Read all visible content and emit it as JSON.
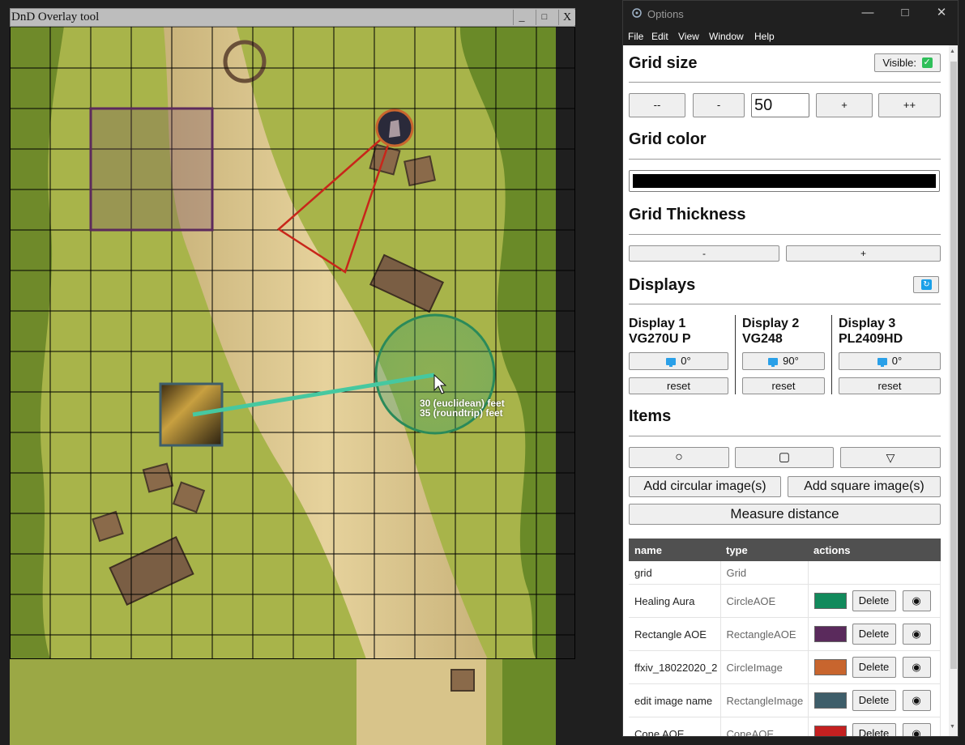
{
  "map_window": {
    "title": "DnD Overlay tool",
    "minimize": "_",
    "maximize": "□",
    "close": "X",
    "measure": {
      "line1": "30 (euclidean) feet",
      "line2": "35 (roundtrip) feet"
    },
    "colors": {
      "grid": "#000000",
      "healing_aura": "#1a8a5a",
      "rectangle_aoe": "#5c2a5c",
      "cone": "#c8261a",
      "measure_line": "#46c8a0"
    }
  },
  "options_window": {
    "title": "Options",
    "menu": [
      "File",
      "Edit",
      "View",
      "Window",
      "Help"
    ],
    "grid_size": {
      "title": "Grid size",
      "visible_label": "Visible:",
      "visible_checked": true,
      "buttons": [
        "--",
        "-",
        "+",
        "++"
      ],
      "value": "50"
    },
    "grid_color": {
      "title": "Grid color",
      "value": "#000000"
    },
    "grid_thickness": {
      "title": "Grid Thickness",
      "minus": "-",
      "plus": "+"
    },
    "displays": {
      "title": "Displays",
      "refresh_icon": "refresh-icon",
      "items": [
        {
          "line1": "Display 1",
          "line2": "VG270U P",
          "rotation": "0°",
          "reset": "reset"
        },
        {
          "line1": "Display 2",
          "line2": "VG248",
          "rotation": "90°",
          "reset": "reset"
        },
        {
          "line1": "Display 3",
          "line2": "PL2409HD",
          "rotation": "0°",
          "reset": "reset"
        }
      ]
    },
    "items": {
      "title": "Items",
      "shape_buttons": [
        "○",
        "▢",
        "▽"
      ],
      "add_circular": "Add circular image(s)",
      "add_square": "Add square image(s)",
      "measure": "Measure distance",
      "columns": [
        "name",
        "type",
        "actions"
      ],
      "rows": [
        {
          "name": "grid",
          "type": "Grid"
        },
        {
          "name": "Healing Aura",
          "type": "CircleAOE",
          "color": "#128a5c",
          "delete": "Delete"
        },
        {
          "name": "Rectangle AOE",
          "type": "RectangleAOE",
          "color": "#5a2a5c",
          "delete": "Delete"
        },
        {
          "name": "ffxiv_18022020_2",
          "type": "CircleImage",
          "color": "#c8652e",
          "delete": "Delete"
        },
        {
          "name": "edit image name",
          "type": "RectangleImage",
          "color": "#3e5e6a",
          "delete": "Delete"
        },
        {
          "name": "Cone AOE",
          "type": "ConeAOE",
          "color": "#c42020",
          "delete": "Delete"
        }
      ]
    }
  }
}
